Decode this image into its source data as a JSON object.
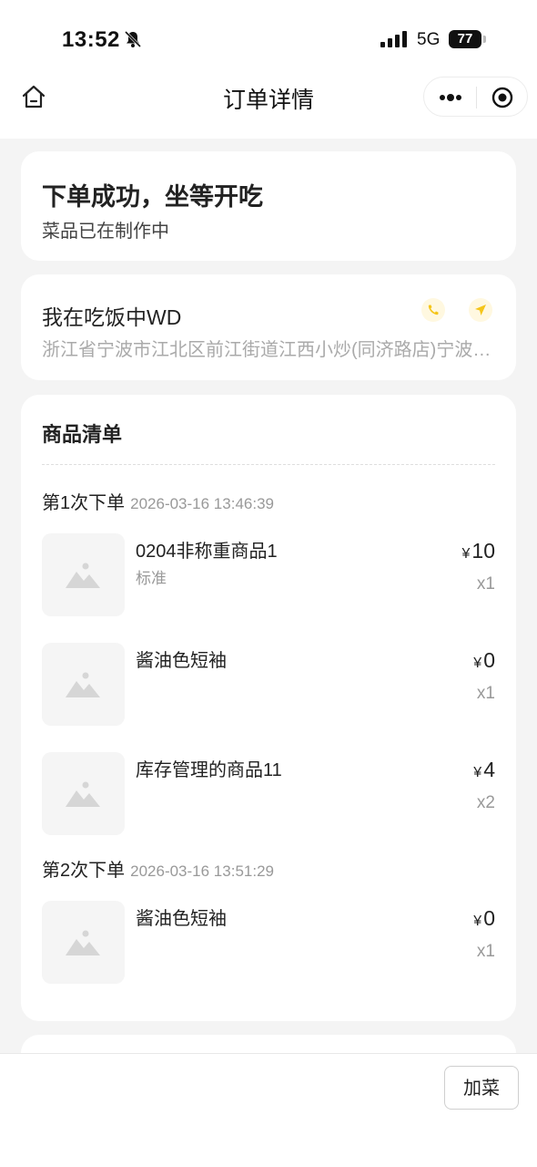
{
  "status_bar": {
    "time": "13:52",
    "network": "5G",
    "battery": "77"
  },
  "nav": {
    "title": "订单详情",
    "home_icon": "home-icon",
    "more_icon": "more-dots-icon",
    "close_icon": "target-circle-icon"
  },
  "order_status": {
    "title": "下单成功，坐等开吃",
    "subtitle": "菜品已在制作中"
  },
  "store": {
    "name": "我在吃饭中WD",
    "address": "浙江省宁波市江北区前江街道江西小炒(同济路店)宁波市江北区",
    "accent_color": "#f5c518"
  },
  "goods": {
    "title": "商品清单",
    "orders": [
      {
        "label": "第1次下单",
        "time": "2026-03-16 13:46:39",
        "items": [
          {
            "name": "0204非称重商品1",
            "spec": "标准",
            "currency": "¥",
            "price": "10",
            "qty": "x1"
          },
          {
            "name": "酱油色短袖",
            "spec": "",
            "currency": "¥",
            "price": "0",
            "qty": "x1"
          },
          {
            "name": "库存管理的商品11",
            "spec": "",
            "currency": "¥",
            "price": "4",
            "qty": "x2"
          }
        ]
      },
      {
        "label": "第2次下单",
        "time": "2026-03-16 13:51:29",
        "items": [
          {
            "name": "酱油色短袖",
            "spec": "",
            "currency": "¥",
            "price": "0",
            "qty": "x1"
          }
        ]
      }
    ]
  },
  "bottom": {
    "add_label": "加菜"
  }
}
